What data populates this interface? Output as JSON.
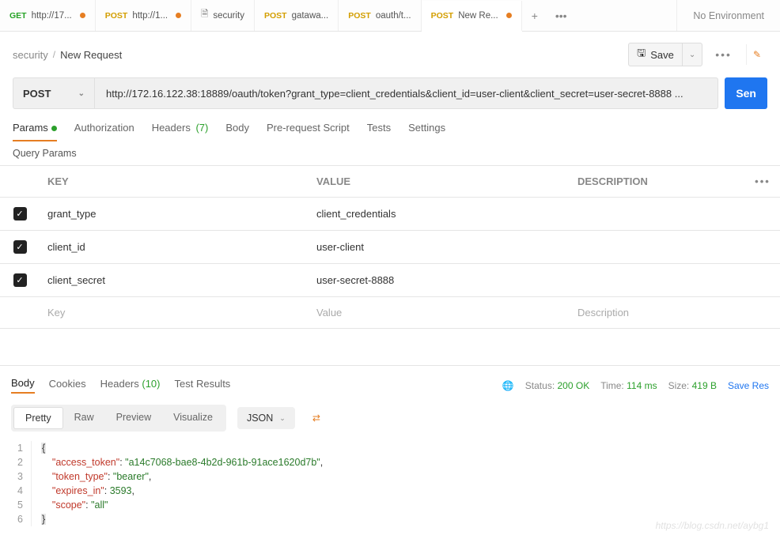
{
  "tabs": [
    {
      "method": "GET",
      "name": "http://17...",
      "dot": true
    },
    {
      "method": "POST",
      "name": "http://1...",
      "dot": true
    },
    {
      "method": "",
      "name": "security",
      "dot": false,
      "file": true
    },
    {
      "method": "POST",
      "name": "gatawa...",
      "dot": false
    },
    {
      "method": "POST",
      "name": "oauth/t...",
      "dot": false
    },
    {
      "method": "POST",
      "name": "New Re...",
      "dot": true,
      "active": true
    }
  ],
  "env_label": "No Environment",
  "breadcrumb": {
    "parent": "security",
    "current": "New Request"
  },
  "save_label": "Save",
  "request": {
    "method": "POST",
    "url": "http://172.16.122.38:18889/oauth/token?grant_type=client_credentials&client_id=user-client&client_secret=user-secret-8888 ..."
  },
  "send_label": "Sen",
  "req_tabs": {
    "params": "Params",
    "auth": "Authorization",
    "headers": "Headers",
    "headers_count": "(7)",
    "body": "Body",
    "prereq": "Pre-request Script",
    "tests": "Tests",
    "settings": "Settings"
  },
  "query_params_title": "Query Params",
  "table": {
    "head": {
      "key": "KEY",
      "value": "VALUE",
      "desc": "DESCRIPTION"
    },
    "rows": [
      {
        "key": "grant_type",
        "value": "client_credentials",
        "desc": ""
      },
      {
        "key": "client_id",
        "value": "user-client",
        "desc": ""
      },
      {
        "key": "client_secret",
        "value": "user-secret-8888",
        "desc": ""
      }
    ],
    "placeholder": {
      "key": "Key",
      "value": "Value",
      "desc": "Description"
    }
  },
  "resp_tabs": {
    "body": "Body",
    "cookies": "Cookies",
    "headers": "Headers",
    "headers_count": "(10)",
    "results": "Test Results"
  },
  "status": {
    "label": "Status:",
    "code": "200 OK",
    "time_label": "Time:",
    "time": "114 ms",
    "size_label": "Size:",
    "size": "419 B"
  },
  "save_response": "Save Res",
  "view_modes": {
    "pretty": "Pretty",
    "raw": "Raw",
    "preview": "Preview",
    "visualize": "Visualize",
    "format": "JSON"
  },
  "response_body": {
    "access_token": "a14c7068-bae8-4b2d-961b-91ace1620d7b",
    "token_type": "bearer",
    "expires_in": 3593,
    "scope": "all"
  },
  "code_lines": {
    "l1": "{",
    "l2a": "    \"access_token\"",
    "l2v": "\"a14c7068-bae8-4b2d-961b-91ace1620d7b\"",
    "l3a": "    \"token_type\"",
    "l3v": "\"bearer\"",
    "l4a": "    \"expires_in\"",
    "l4v": "3593",
    "l5a": "    \"scope\"",
    "l5v": "\"all\"",
    "l6": "}"
  },
  "watermark": "https://blog.csdn.net/aybg1"
}
